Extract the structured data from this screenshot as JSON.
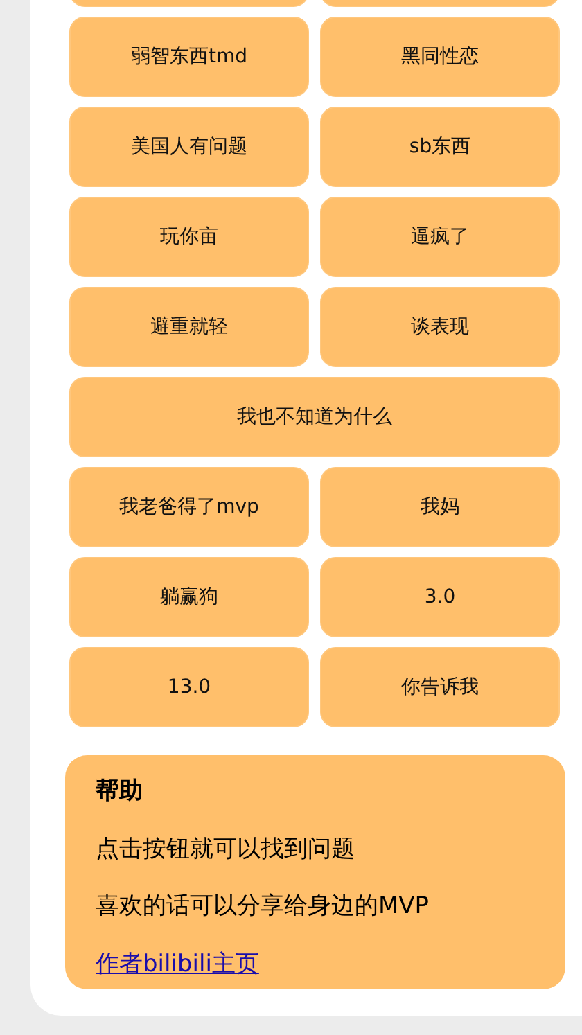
{
  "top_row_cut": true,
  "buttons": [
    {
      "label": "弱智东西tmd",
      "wide": false
    },
    {
      "label": "黑同性恋",
      "wide": false
    },
    {
      "label": "美国人有问题",
      "wide": false
    },
    {
      "label": "sb东西",
      "wide": false
    },
    {
      "label": "玩你亩",
      "wide": false
    },
    {
      "label": "逼疯了",
      "wide": false
    },
    {
      "label": "避重就轻",
      "wide": false
    },
    {
      "label": "谈表现",
      "wide": false
    },
    {
      "label": "我也不知道为什么",
      "wide": true
    },
    {
      "label": "我老爸得了mvp",
      "wide": false
    },
    {
      "label": "我妈",
      "wide": false
    },
    {
      "label": "躺赢狗",
      "wide": false
    },
    {
      "label": "3.0",
      "wide": false
    },
    {
      "label": "13.0",
      "wide": false
    },
    {
      "label": "你告诉我",
      "wide": false
    }
  ],
  "help": {
    "title": "帮助",
    "lines": [
      "点击按钮就可以找到问题",
      "喜欢的话可以分享给身边的MVP"
    ],
    "link": "作者bilibili主页"
  }
}
